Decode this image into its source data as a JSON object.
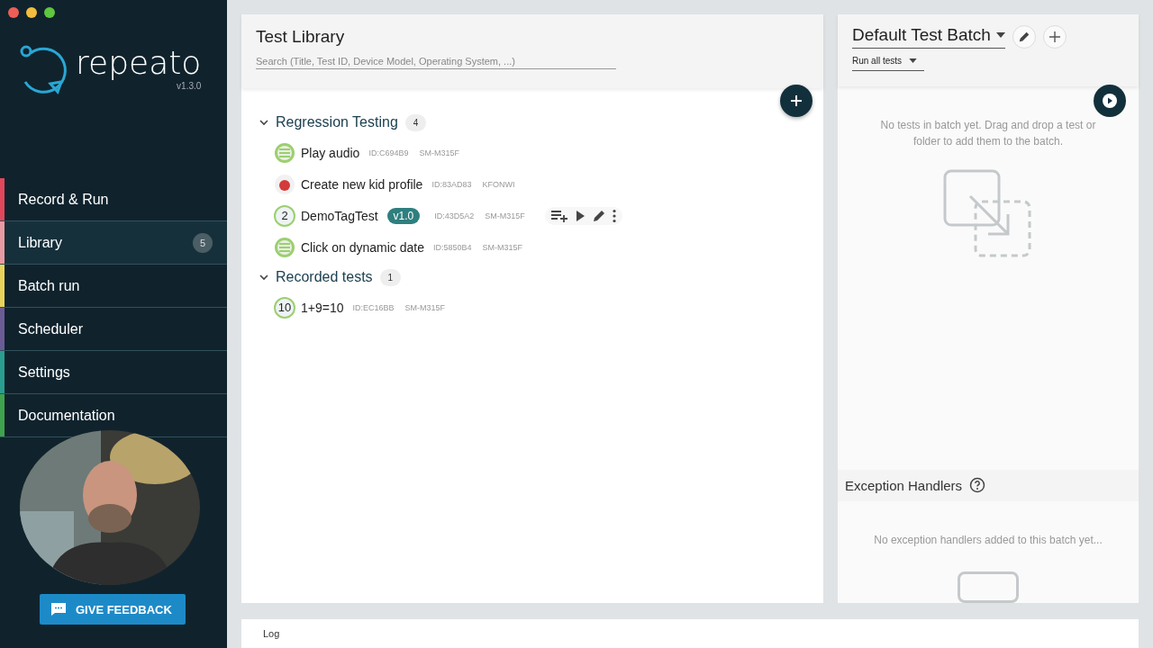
{
  "app": {
    "name": "repeato",
    "version": "v1.3.0"
  },
  "nav": [
    {
      "label": "Record & Run",
      "color": "#e0475b",
      "selected": false
    },
    {
      "label": "Library",
      "color": "#e89aa3",
      "selected": true,
      "badge": "5"
    },
    {
      "label": "Batch run",
      "color": "#e8d35a",
      "selected": false
    },
    {
      "label": "Scheduler",
      "color": "#6b5b95",
      "selected": false
    },
    {
      "label": "Settings",
      "color": "#2a9d8f",
      "selected": false
    },
    {
      "label": "Documentation",
      "color": "#3fa34d",
      "selected": false
    }
  ],
  "feedback_button": "GIVE FEEDBACK",
  "library": {
    "title": "Test Library",
    "search": {
      "placeholder": "Search (Title, Test ID, Device Model, Operating System, ...)"
    },
    "folders": [
      {
        "name": "Regression Testing",
        "count": "4",
        "expanded": true,
        "tests": [
          {
            "title": "Play audio",
            "kind": "list",
            "id": "ID:C694B9",
            "device": "SM-M315F",
            "show_actions": false
          },
          {
            "title": "Create new kid profile",
            "kind": "avatar",
            "id": "ID:83AD83",
            "device": "KFONWI",
            "show_actions": false
          },
          {
            "title": "DemoTagTest",
            "kind": "number",
            "icon_text": "2",
            "tag": "v1.0",
            "id": "ID:43D5A2",
            "device": "SM-M315F",
            "show_actions": true
          },
          {
            "title": "Click on dynamic date",
            "kind": "list",
            "id": "ID:5850B4",
            "device": "SM-M315F",
            "show_actions": false
          }
        ]
      },
      {
        "name": "Recorded tests",
        "count": "1",
        "expanded": true,
        "tests": [
          {
            "title": "1+9=10",
            "kind": "number",
            "icon_text": "10",
            "id": "ID:EC16BB",
            "device": "SM-M315F",
            "show_actions": false
          }
        ]
      }
    ]
  },
  "batch": {
    "title": "Default Test Batch",
    "mode": "Run all tests",
    "empty_text": "No tests in batch yet. Drag and drop a test or folder to add them to the batch."
  },
  "exception_handlers": {
    "title": "Exception Handlers",
    "empty_text": "No exception handlers added to this batch yet..."
  },
  "log": {
    "label": "Log"
  }
}
